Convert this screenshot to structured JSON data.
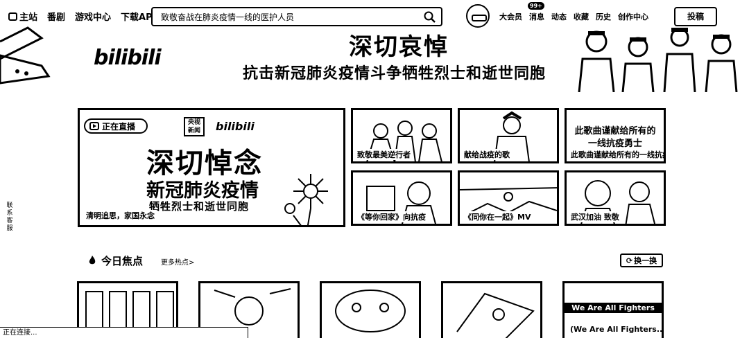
{
  "topbar": {
    "nav_left": [
      "主站",
      "番剧",
      "游戏中心",
      "下载APP"
    ],
    "search_placeholder": "致敬奋战在肺炎疫情一线的医护人员",
    "nav_right": [
      "大会员",
      "消息",
      "动态",
      "收藏",
      "历史",
      "创作中心"
    ],
    "badge": "99+",
    "upload": "投稿"
  },
  "banner": {
    "logo": "bilibili",
    "title": "深切哀悼",
    "subtitle": "抗击新冠肺炎疫情斗争牺牲烈士和逝世同胞"
  },
  "promo": {
    "live_label": "正在直播",
    "stamp": "央视新闻",
    "logo": "bilibili",
    "line1": "深切悼念",
    "line2": "新冠肺炎疫情",
    "line3": "牺牲烈士和逝世同胞",
    "caption": "清明追思，家国永念",
    "cards": [
      {
        "caption": "致敬最美逆行者",
        "overlay": ""
      },
      {
        "caption": "献给战疫的歌",
        "overlay": ""
      },
      {
        "caption": "此歌曲谨献给所有的一线抗疫勇士",
        "overlay": "此歌曲谨献给所有的\n一线抗疫勇士"
      },
      {
        "caption": "《等你回家》向抗疫",
        "overlay": ""
      },
      {
        "caption": "《同你在一起》MV",
        "overlay": ""
      },
      {
        "caption": "武汉加油 致敬",
        "overlay": ""
      }
    ]
  },
  "side_tab": "联系客服",
  "hot": {
    "title": "今日焦点",
    "more": "更多热点>",
    "refresh": "换一换",
    "items": [
      {
        "caption": "",
        "overlay": ""
      },
      {
        "caption": "",
        "overlay": ""
      },
      {
        "caption": "",
        "overlay": ""
      },
      {
        "caption": "",
        "overlay": ""
      },
      {
        "caption": "(We Are All Fighters...",
        "overlay": "We Are All Fighters"
      }
    ]
  },
  "status": "正在连接..."
}
